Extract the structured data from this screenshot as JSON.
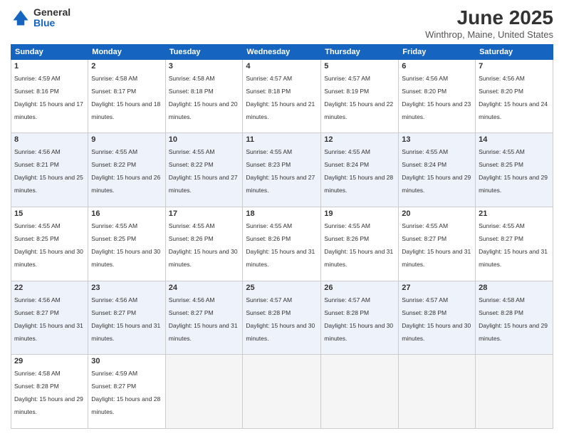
{
  "header": {
    "logo_general": "General",
    "logo_blue": "Blue",
    "title": "June 2025",
    "location": "Winthrop, Maine, United States"
  },
  "days_of_week": [
    "Sunday",
    "Monday",
    "Tuesday",
    "Wednesday",
    "Thursday",
    "Friday",
    "Saturday"
  ],
  "weeks": [
    [
      {
        "num": "1",
        "sunrise": "Sunrise: 4:59 AM",
        "sunset": "Sunset: 8:16 PM",
        "daylight": "Daylight: 15 hours and 17 minutes."
      },
      {
        "num": "2",
        "sunrise": "Sunrise: 4:58 AM",
        "sunset": "Sunset: 8:17 PM",
        "daylight": "Daylight: 15 hours and 18 minutes."
      },
      {
        "num": "3",
        "sunrise": "Sunrise: 4:58 AM",
        "sunset": "Sunset: 8:18 PM",
        "daylight": "Daylight: 15 hours and 20 minutes."
      },
      {
        "num": "4",
        "sunrise": "Sunrise: 4:57 AM",
        "sunset": "Sunset: 8:18 PM",
        "daylight": "Daylight: 15 hours and 21 minutes."
      },
      {
        "num": "5",
        "sunrise": "Sunrise: 4:57 AM",
        "sunset": "Sunset: 8:19 PM",
        "daylight": "Daylight: 15 hours and 22 minutes."
      },
      {
        "num": "6",
        "sunrise": "Sunrise: 4:56 AM",
        "sunset": "Sunset: 8:20 PM",
        "daylight": "Daylight: 15 hours and 23 minutes."
      },
      {
        "num": "7",
        "sunrise": "Sunrise: 4:56 AM",
        "sunset": "Sunset: 8:20 PM",
        "daylight": "Daylight: 15 hours and 24 minutes."
      }
    ],
    [
      {
        "num": "8",
        "sunrise": "Sunrise: 4:56 AM",
        "sunset": "Sunset: 8:21 PM",
        "daylight": "Daylight: 15 hours and 25 minutes."
      },
      {
        "num": "9",
        "sunrise": "Sunrise: 4:55 AM",
        "sunset": "Sunset: 8:22 PM",
        "daylight": "Daylight: 15 hours and 26 minutes."
      },
      {
        "num": "10",
        "sunrise": "Sunrise: 4:55 AM",
        "sunset": "Sunset: 8:22 PM",
        "daylight": "Daylight: 15 hours and 27 minutes."
      },
      {
        "num": "11",
        "sunrise": "Sunrise: 4:55 AM",
        "sunset": "Sunset: 8:23 PM",
        "daylight": "Daylight: 15 hours and 27 minutes."
      },
      {
        "num": "12",
        "sunrise": "Sunrise: 4:55 AM",
        "sunset": "Sunset: 8:24 PM",
        "daylight": "Daylight: 15 hours and 28 minutes."
      },
      {
        "num": "13",
        "sunrise": "Sunrise: 4:55 AM",
        "sunset": "Sunset: 8:24 PM",
        "daylight": "Daylight: 15 hours and 29 minutes."
      },
      {
        "num": "14",
        "sunrise": "Sunrise: 4:55 AM",
        "sunset": "Sunset: 8:25 PM",
        "daylight": "Daylight: 15 hours and 29 minutes."
      }
    ],
    [
      {
        "num": "15",
        "sunrise": "Sunrise: 4:55 AM",
        "sunset": "Sunset: 8:25 PM",
        "daylight": "Daylight: 15 hours and 30 minutes."
      },
      {
        "num": "16",
        "sunrise": "Sunrise: 4:55 AM",
        "sunset": "Sunset: 8:25 PM",
        "daylight": "Daylight: 15 hours and 30 minutes."
      },
      {
        "num": "17",
        "sunrise": "Sunrise: 4:55 AM",
        "sunset": "Sunset: 8:26 PM",
        "daylight": "Daylight: 15 hours and 30 minutes."
      },
      {
        "num": "18",
        "sunrise": "Sunrise: 4:55 AM",
        "sunset": "Sunset: 8:26 PM",
        "daylight": "Daylight: 15 hours and 31 minutes."
      },
      {
        "num": "19",
        "sunrise": "Sunrise: 4:55 AM",
        "sunset": "Sunset: 8:26 PM",
        "daylight": "Daylight: 15 hours and 31 minutes."
      },
      {
        "num": "20",
        "sunrise": "Sunrise: 4:55 AM",
        "sunset": "Sunset: 8:27 PM",
        "daylight": "Daylight: 15 hours and 31 minutes."
      },
      {
        "num": "21",
        "sunrise": "Sunrise: 4:55 AM",
        "sunset": "Sunset: 8:27 PM",
        "daylight": "Daylight: 15 hours and 31 minutes."
      }
    ],
    [
      {
        "num": "22",
        "sunrise": "Sunrise: 4:56 AM",
        "sunset": "Sunset: 8:27 PM",
        "daylight": "Daylight: 15 hours and 31 minutes."
      },
      {
        "num": "23",
        "sunrise": "Sunrise: 4:56 AM",
        "sunset": "Sunset: 8:27 PM",
        "daylight": "Daylight: 15 hours and 31 minutes."
      },
      {
        "num": "24",
        "sunrise": "Sunrise: 4:56 AM",
        "sunset": "Sunset: 8:27 PM",
        "daylight": "Daylight: 15 hours and 31 minutes."
      },
      {
        "num": "25",
        "sunrise": "Sunrise: 4:57 AM",
        "sunset": "Sunset: 8:28 PM",
        "daylight": "Daylight: 15 hours and 30 minutes."
      },
      {
        "num": "26",
        "sunrise": "Sunrise: 4:57 AM",
        "sunset": "Sunset: 8:28 PM",
        "daylight": "Daylight: 15 hours and 30 minutes."
      },
      {
        "num": "27",
        "sunrise": "Sunrise: 4:57 AM",
        "sunset": "Sunset: 8:28 PM",
        "daylight": "Daylight: 15 hours and 30 minutes."
      },
      {
        "num": "28",
        "sunrise": "Sunrise: 4:58 AM",
        "sunset": "Sunset: 8:28 PM",
        "daylight": "Daylight: 15 hours and 29 minutes."
      }
    ],
    [
      {
        "num": "29",
        "sunrise": "Sunrise: 4:58 AM",
        "sunset": "Sunset: 8:28 PM",
        "daylight": "Daylight: 15 hours and 29 minutes."
      },
      {
        "num": "30",
        "sunrise": "Sunrise: 4:59 AM",
        "sunset": "Sunset: 8:27 PM",
        "daylight": "Daylight: 15 hours and 28 minutes."
      },
      null,
      null,
      null,
      null,
      null
    ]
  ]
}
